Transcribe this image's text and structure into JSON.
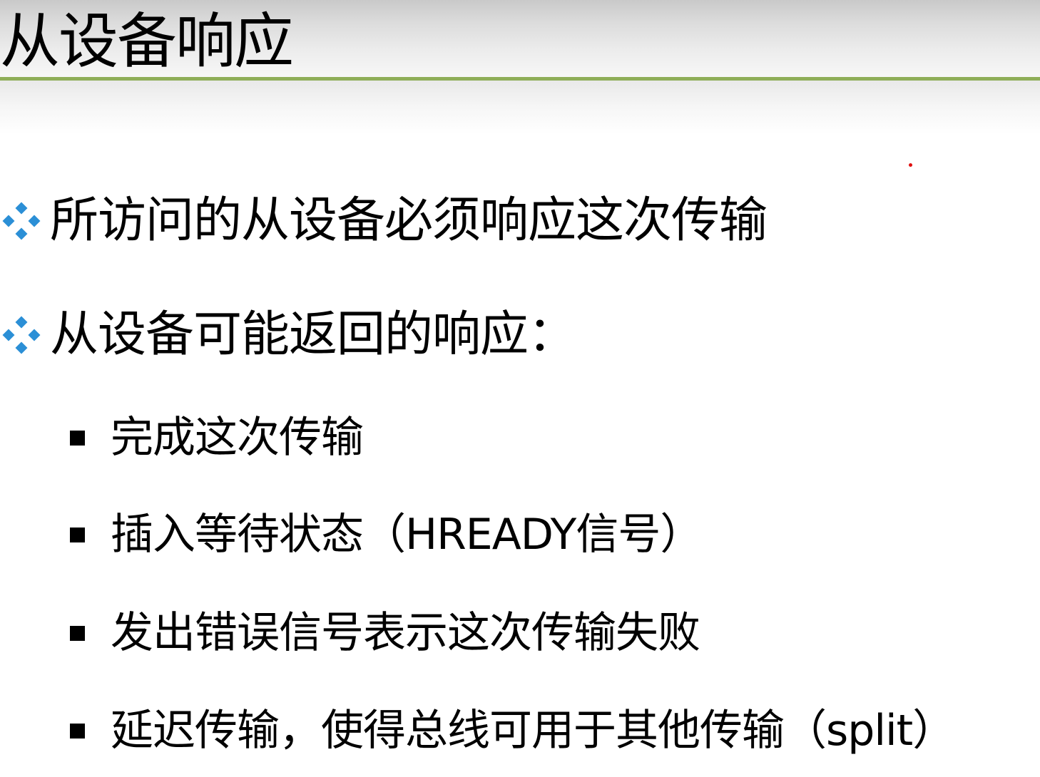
{
  "slide": {
    "title": "从设备响应",
    "bullets": [
      {
        "icon": "diamond-bullet-icon",
        "text": "所访问的从设备必须响应这次传输"
      },
      {
        "icon": "diamond-bullet-icon",
        "text": "从设备可能返回的响应："
      }
    ],
    "sub_bullets": [
      {
        "icon": "square-bullet-icon",
        "text": "完成这次传输"
      },
      {
        "icon": "square-bullet-icon",
        "text": "插入等待状态（HREADY信号）"
      },
      {
        "icon": "square-bullet-icon",
        "text": "发出错误信号表示这次传输失败"
      },
      {
        "icon": "square-bullet-icon",
        "text": "延迟传输，使得总线可用于其他传输（split）"
      }
    ]
  },
  "colors": {
    "title_rule": "#8fae58",
    "diamond_bullet": "#2b8fd6",
    "text": "#000000",
    "laser_dot": "#e01010"
  }
}
